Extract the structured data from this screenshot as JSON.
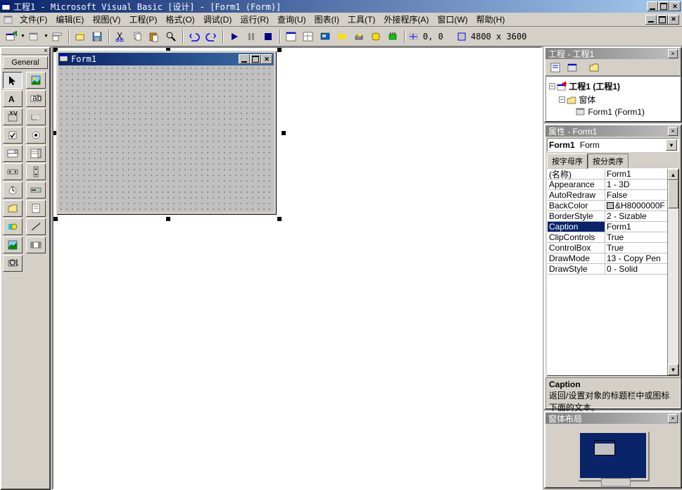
{
  "app": {
    "title": "工程1 - Microsoft Visual Basic [设计] - [Form1 (Form)]"
  },
  "menus": [
    "文件(F)",
    "编辑(E)",
    "视图(V)",
    "工程(P)",
    "格式(O)",
    "调试(D)",
    "运行(R)",
    "查询(U)",
    "图表(I)",
    "工具(T)",
    "外接程序(A)",
    "窗口(W)",
    "帮助(H)"
  ],
  "toolbar_status": {
    "pos": "0, 0",
    "size": "4800 x 3600"
  },
  "toolbox": {
    "tab": "General"
  },
  "form": {
    "caption": "Form1"
  },
  "project_panel": {
    "title": "工程 - 工程1",
    "root": "工程1 (工程1)",
    "folder": "窗体",
    "item": "Form1 (Form1)"
  },
  "properties_panel": {
    "title": "属性 - Form1",
    "object_bold": "Form1",
    "object_type": "Form",
    "tabs": [
      "按字母序",
      "按分类序"
    ],
    "rows": [
      {
        "name": "(名称)",
        "value": "Form1"
      },
      {
        "name": "Appearance",
        "value": "1 - 3D"
      },
      {
        "name": "AutoRedraw",
        "value": "False"
      },
      {
        "name": "BackColor",
        "value": "&H8000000F",
        "color": "#c0c0c0"
      },
      {
        "name": "BorderStyle",
        "value": "2 - Sizable"
      },
      {
        "name": "Caption",
        "value": "Form1",
        "selected": true
      },
      {
        "name": "ClipControls",
        "value": "True"
      },
      {
        "name": "ControlBox",
        "value": "True"
      },
      {
        "name": "DrawMode",
        "value": "13 - Copy Pen"
      },
      {
        "name": "DrawStyle",
        "value": "0 - Solid"
      }
    ],
    "desc_title": "Caption",
    "desc_text": "返回/设置对象的标题栏中或图标下面的文本。"
  },
  "layout_panel": {
    "title": "窗体布局"
  }
}
